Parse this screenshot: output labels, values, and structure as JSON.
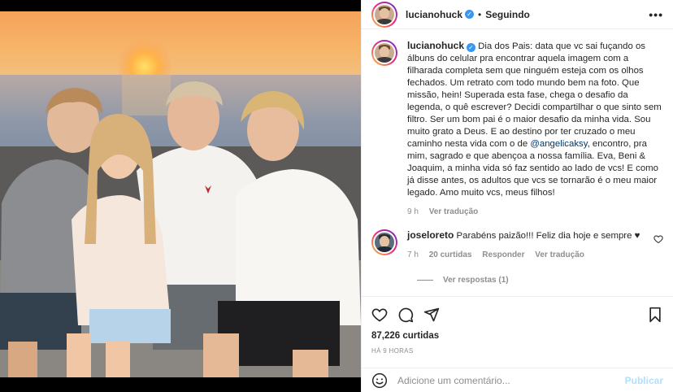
{
  "post": {
    "username": "lucianohuck",
    "follow_status": "Seguindo",
    "caption_user": "lucianohuck",
    "caption_before": " Dia dos Pais: data que vc sai fuçando os álbuns do celular pra encontrar aquela imagem com a filharada completa sem que ninguém esteja com os olhos fechados. Um retrato com todo mundo bem na foto. Que missão, hein! Superada esta fase, chega o desafio da legenda, o quê escrever? Decidi compartilhar o que sinto sem filtro. Ser um bom pai é o maior desafio da minha vida. Sou muito grato a Deus. E ao destino por ter cruzado o meu caminho nesta vida com o de ",
    "caption_mention": "@angelicaksy",
    "caption_after": ", encontro, pra mim, sagrado e que abençoa a nossa família. Eva, Beni & Joaquim, a minha vida só faz sentido ao lado de vcs! E como já disse antes, os adultos que vcs se tornarão é o meu maior legado. Amo muito vcs, meus filhos!",
    "caption_time": "9 h",
    "caption_translate": "Ver tradução",
    "likes": "87,226 curtidas",
    "posted_ago": "HÁ 9 HORAS"
  },
  "comment": {
    "username": "joseloreto",
    "text": " Parabéns paizão!!! Feliz dia hoje e sempre ♥",
    "time": "7 h",
    "likes": "20 curtidas",
    "reply": "Responder",
    "translate": "Ver tradução",
    "view_replies": "Ver respostas (1)"
  },
  "add_comment": {
    "placeholder": "Adicione um comentário...",
    "publish": "Publicar"
  },
  "icons": {
    "more": "more-options-icon",
    "like": "heart-icon",
    "comment": "comment-icon",
    "share": "share-icon",
    "save": "bookmark-icon",
    "emoji": "emoji-icon",
    "verified": "verified-badge-icon"
  },
  "colors": {
    "verified": "#3897f0",
    "link": "#00376b",
    "muted": "#8e8e8e",
    "publish_disabled": "#b2dffc"
  }
}
